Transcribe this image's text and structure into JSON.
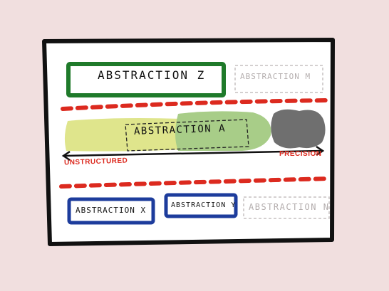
{
  "boxes": {
    "z": "ABSTRACTION Z",
    "m": "ABSTRACTION M",
    "a": "ABSTRACTION A",
    "x": "ABSTRACTION X",
    "y": "ABSTRACTION Y",
    "n": "ABSTRACTION N"
  },
  "axis": {
    "left": "UNSTRUCTURED",
    "right": "PRECISION"
  },
  "colors": {
    "background": "#f1dfdf",
    "frame_border": "#111111",
    "frame_fill": "#ffffff",
    "green_box": "#1f7a2a",
    "blue_box": "#1d3c9c",
    "faded_box": "#c6c0c0",
    "red_dashes": "#dc2a1f",
    "wash_yellow": "#dfe58c",
    "wash_green": "#a8cd88",
    "wash_gray": "#6f6f6f"
  }
}
